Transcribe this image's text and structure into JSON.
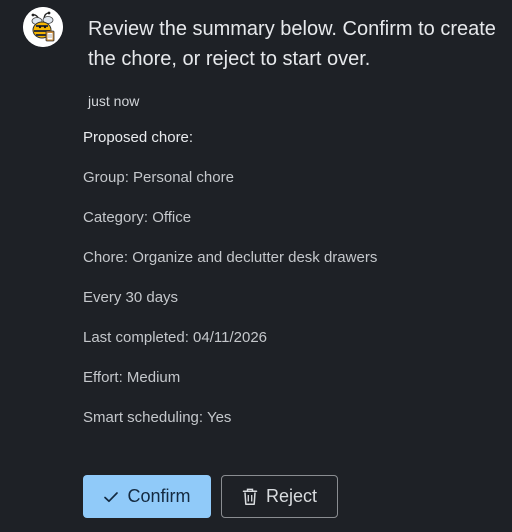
{
  "assistant": {
    "avatar_icon": "bee-icon",
    "message": "Review the summary below. Confirm to create the chore, or reject to start over.",
    "timestamp": "just now"
  },
  "summary": {
    "heading": "Proposed chore:",
    "lines": [
      "Group: Personal chore",
      "Category: Office",
      "Chore: Organize and declutter desk drawers",
      "Every 30 days",
      "Last completed: 04/11/2026",
      "Effort: Medium",
      "Smart scheduling: Yes"
    ]
  },
  "actions": {
    "confirm_label": "Confirm",
    "confirm_icon": "check-icon",
    "reject_label": "Reject",
    "reject_icon": "trash-icon"
  },
  "colors": {
    "background": "#1e2126",
    "confirm_bg": "#90caf9",
    "reject_border": "#8a8d91"
  }
}
